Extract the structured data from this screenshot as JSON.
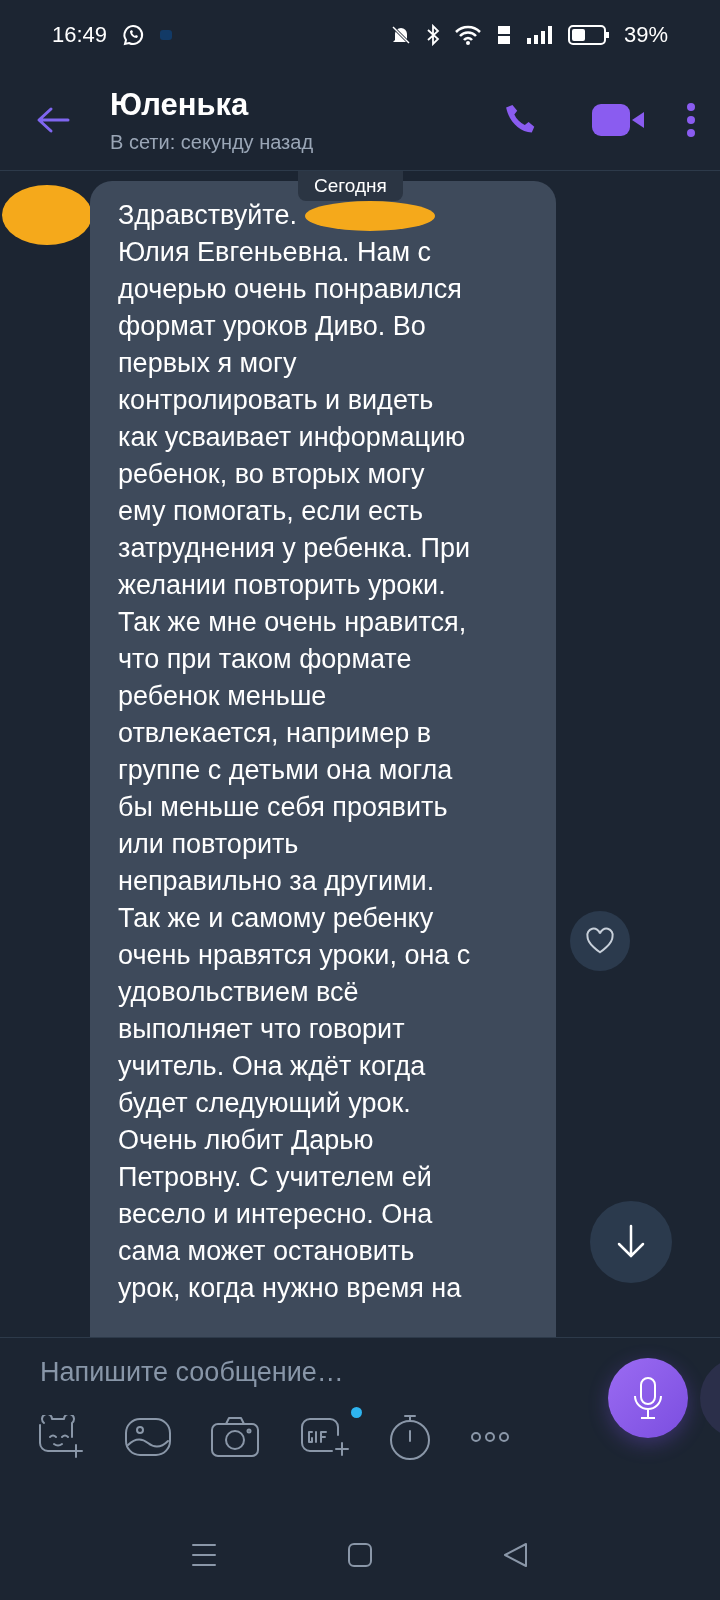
{
  "status_bar": {
    "time": "16:49",
    "battery": "39%"
  },
  "header": {
    "title": "Юленька",
    "subtitle": "В сети: секунду назад"
  },
  "date_chip": "Сегодня",
  "message": {
    "greeting": "Здравствуйте.",
    "text": "Юлия Евгеньевна. Нам с\nдочерью очень понравился\nформат уроков Диво. Во\nпервых я могу\nконтролировать и видеть\nкак усваивает информацию\nребенок, во вторых могу\nему помогать, если есть\nзатруднения у ребенка. При\nжелании повторить уроки.\nТак же мне очень нравится,\nчто при таком формате\nребенок меньше\nотвлекается, например в\nгруппе с детьми она могла\nбы меньше себя проявить\nили повторить\nнеправильно за другими.\nТак же и самому ребенку\nочень нравятся уроки, она с\nудовольствием всё\nвыполняет что говорит\nучитель. Она ждёт когда\nбудет следующий урок.\nОчень любит Дарью\nПетровну. С учителем ей\nвесело и интересно. Она\nсама может остановить\nурок, когда нужно время на",
    "liked": false
  },
  "composer": {
    "placeholder": "Напишите сообщение…",
    "gif_badge": true
  }
}
